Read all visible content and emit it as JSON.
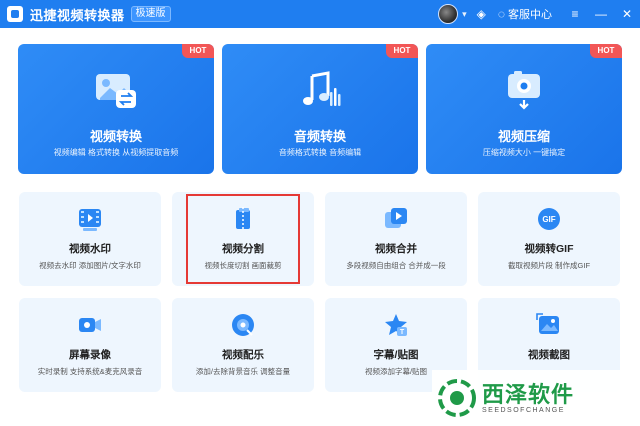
{
  "titlebar": {
    "app_title": "迅捷视频转换器",
    "edition": "极速版",
    "service_label": "客服中心",
    "minimize": "—",
    "close": "✕"
  },
  "top_cards": [
    {
      "title": "视频转换",
      "subtitle": "视频编辑 格式转换 从视频提取音频",
      "badge": "HOT",
      "icon": "video-convert-icon"
    },
    {
      "title": "音频转换",
      "subtitle": "音频格式转换 音频编辑",
      "badge": "HOT",
      "icon": "audio-convert-icon"
    },
    {
      "title": "视频压缩",
      "subtitle": "压缩视频大小 一键搞定",
      "badge": "HOT",
      "icon": "video-compress-icon"
    }
  ],
  "tools": [
    {
      "title": "视频水印",
      "subtitle": "视频去水印 添加图片/文字水印",
      "icon": "watermark-icon"
    },
    {
      "title": "视频分割",
      "subtitle": "视频长度切割 画面裁剪",
      "icon": "split-icon"
    },
    {
      "title": "视频合并",
      "subtitle": "多段视频自由组合 合并成一段",
      "icon": "merge-icon"
    },
    {
      "title": "视频转GIF",
      "subtitle": "截取视频片段 制作成GIF",
      "icon": "gif-icon"
    },
    {
      "title": "屏幕录像",
      "subtitle": "实时录制 支持系统&麦克风录音",
      "icon": "screen-record-icon"
    },
    {
      "title": "视频配乐",
      "subtitle": "添加/去除背景音乐 调整音量",
      "icon": "music-icon"
    },
    {
      "title": "字幕/贴图",
      "subtitle": "视频添加字幕/贴图",
      "icon": "subtitle-icon"
    },
    {
      "title": "视频截图",
      "subtitle": "",
      "icon": "screenshot-icon"
    }
  ],
  "watermark": {
    "main": "西泽软件",
    "sub": "SEEDSOFCHANGE"
  },
  "colors": {
    "accent": "#1f7ef0",
    "card_bg": "#eef6fe",
    "hot": "#f25656",
    "highlight": "#e53935"
  }
}
